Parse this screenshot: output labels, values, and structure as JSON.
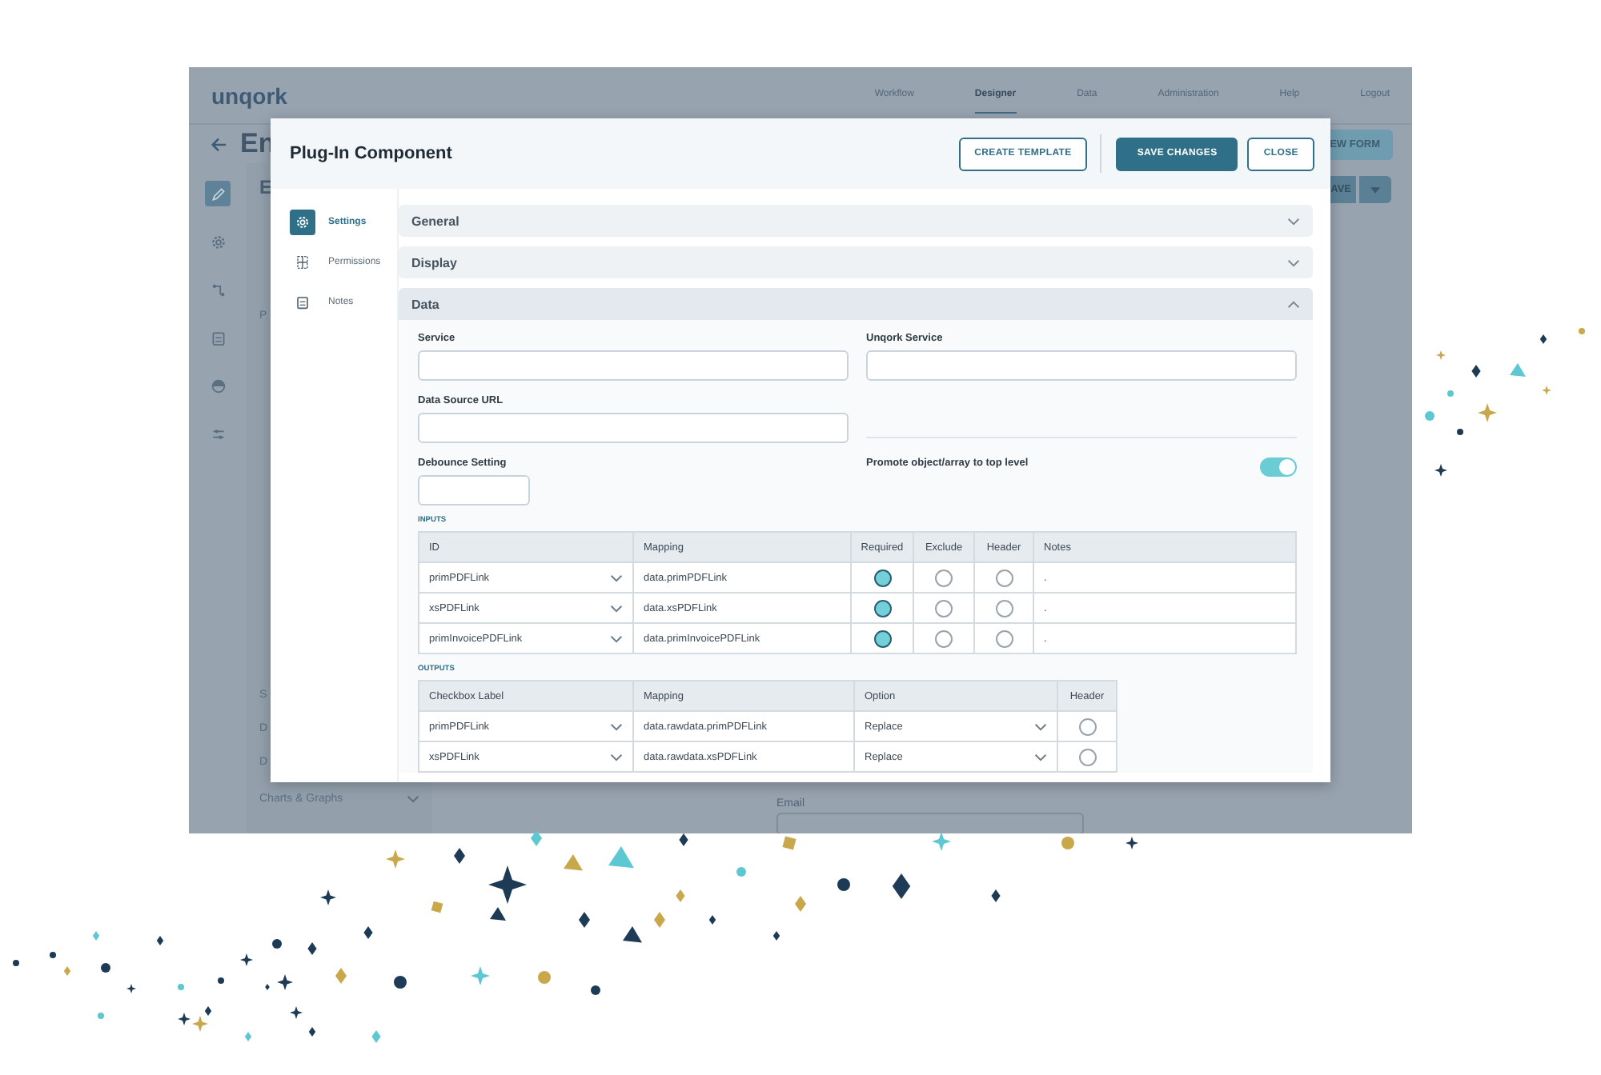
{
  "app": {
    "logo": "unqork",
    "nav": [
      {
        "label": "Workflow",
        "selected": false
      },
      {
        "label": "Designer",
        "selected": true
      },
      {
        "label": "Data",
        "selected": false
      },
      {
        "label": "Administration",
        "selected": false
      },
      {
        "label": "Help",
        "selected": false
      },
      {
        "label": "Logout",
        "selected": false
      }
    ],
    "page_title": "En",
    "subtitle": "E",
    "new_form_button": "EW FORM",
    "save_button": "AVE",
    "rail": [
      {
        "selected": true
      },
      {
        "selected": false
      },
      {
        "selected": false
      },
      {
        "selected": false
      },
      {
        "selected": false
      },
      {
        "selected": false
      }
    ],
    "left_panel": {
      "heading_letter": "P",
      "letters": [
        "S",
        "D",
        "D"
      ],
      "category": "Charts & Graphs"
    },
    "canvas": {
      "field_label": "Email"
    }
  },
  "modal": {
    "title": "Plug-In Component",
    "buttons": [
      {
        "label": "CREATE TEMPLATE",
        "kind": "outline"
      },
      {
        "label": "SAVE CHANGES",
        "kind": "primary"
      },
      {
        "label": "CLOSE",
        "kind": "outline"
      }
    ],
    "nav": [
      {
        "label": "Settings",
        "selected": true
      },
      {
        "label": "Permissions",
        "selected": false
      },
      {
        "label": "Notes",
        "selected": false
      }
    ],
    "sections": [
      {
        "title": "General",
        "expanded": false
      },
      {
        "title": "Display",
        "expanded": false
      },
      {
        "title": "Data",
        "expanded": true
      }
    ],
    "data": {
      "fields": [
        {
          "label": "Service"
        },
        {
          "label": "Unqork Service"
        },
        {
          "label": "Data Source URL"
        }
      ],
      "debounce": {
        "label": "Debounce Setting"
      },
      "promote": {
        "label": "Promote object/array to top level",
        "on": true
      },
      "inputs": {
        "title": "INPUTS",
        "columns": [
          "ID",
          "Mapping",
          "Required",
          "Exclude",
          "Header",
          "Notes"
        ],
        "rows": [
          {
            "id": "primPDFLink",
            "mapping": "data.primPDFLink",
            "required": true,
            "exclude": false,
            "header": false,
            "notes": "."
          },
          {
            "id": "xsPDFLink",
            "mapping": "data.xsPDFLink",
            "required": true,
            "exclude": false,
            "header": false,
            "notes": "."
          },
          {
            "id": "primInvoicePDFLink",
            "mapping": "data.primInvoicePDFLink",
            "required": true,
            "exclude": false,
            "header": false,
            "notes": "."
          }
        ]
      },
      "outputs": {
        "title": "OUTPUTS",
        "columns": [
          "Checkbox Label",
          "Mapping",
          "Option",
          "Header"
        ],
        "rows": [
          {
            "label": "primPDFLink",
            "mapping": "data.rawdata.primPDFLink",
            "option": "Replace",
            "header": false
          },
          {
            "label": "xsPDFLink",
            "mapping": "data.rawdata.xsPDFLink",
            "option": "Replace",
            "header": false
          }
        ]
      }
    }
  }
}
